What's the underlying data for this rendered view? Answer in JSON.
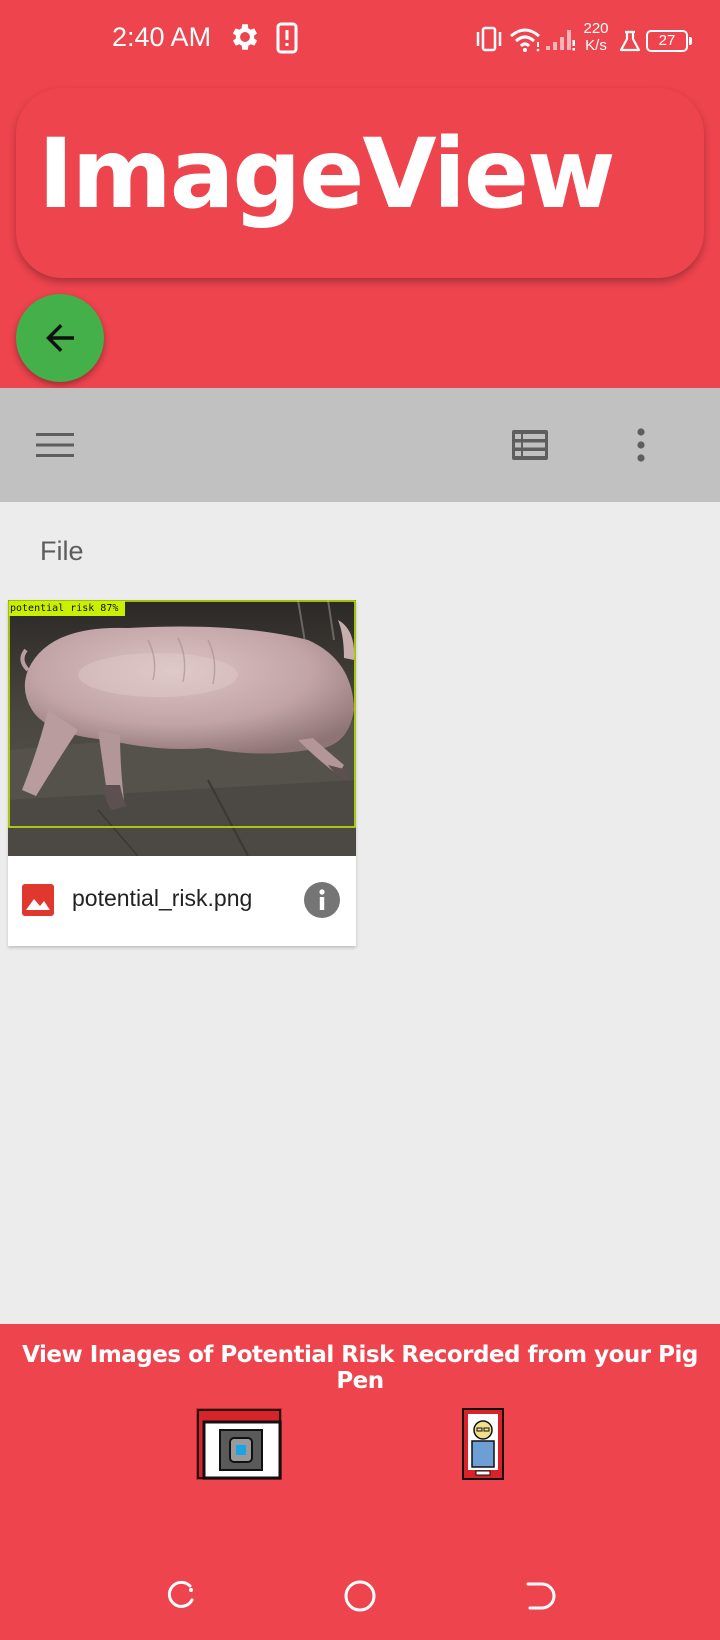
{
  "status_bar": {
    "time": "2:40 AM",
    "speed_value": "220",
    "speed_unit": "K/s",
    "battery": "27",
    "icons": [
      "gear-icon",
      "sim-alert-icon",
      "vibrate-icon",
      "wifi-icon",
      "signal-icon",
      "flask-icon",
      "battery-icon"
    ]
  },
  "header": {
    "title": "ImageView",
    "back_icon": "arrow-left-icon"
  },
  "toolbar": {
    "icons": [
      "menu-icon",
      "list-view-icon",
      "more-vert-icon"
    ]
  },
  "section": {
    "label": "File"
  },
  "files": [
    {
      "name": "potential_risk.png",
      "detection_label": "potential risk 87%",
      "type_icon": "image-icon",
      "action_icon": "info-icon"
    }
  ],
  "bottom_nav": {
    "title": "View Images of Potential Risk Recorded from your Pig Pen",
    "items": [
      "camera-nav-icon",
      "farmer-nav-icon"
    ]
  },
  "colors": {
    "primary": "#ee444e",
    "fab": "#43b04a",
    "toolbar": "#c1c1c1",
    "background": "#ececec",
    "detection": "#c8f000"
  }
}
